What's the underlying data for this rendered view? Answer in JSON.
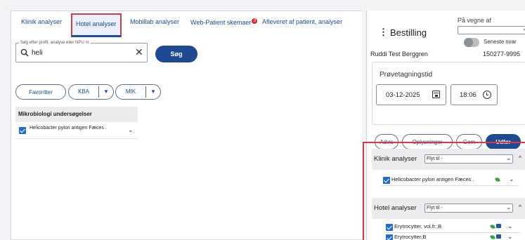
{
  "tabs": [
    {
      "label": "Klinik analyser",
      "active": false
    },
    {
      "label": "Hotel analyser",
      "active": true
    },
    {
      "label": "Mobillab analyser",
      "active": false
    },
    {
      "label": "Web-Patient skemaer",
      "active": false,
      "badge": "3"
    },
    {
      "label": "Afleveret af patient, analyser",
      "active": false
    }
  ],
  "search": {
    "legend": "Søg efter profil, analyse eller NPU nr",
    "value": "heli",
    "button_label": "Søg"
  },
  "filters": {
    "favorites_label": "Favoritter",
    "kba_label": "KBA",
    "mik_label": "MIK",
    "filter_symbol": "▼"
  },
  "results": {
    "group_title": "Mikrobiologi undersøgelser",
    "items": [
      {
        "label": "Helicobacter pylori antigen Fæces .",
        "checked": true
      }
    ]
  },
  "order": {
    "title": "Bestilling",
    "on_behalf_label": "På vegne af",
    "on_behalf_value": "",
    "latest_answer_label": "Seneste svar",
    "patient_name": "Ruddi Test Berggren",
    "patient_id": "150277-9995",
    "sampling_label": "Prøvetagningstid",
    "date": "03-12-2025",
    "time": "18:06",
    "buttons": {
      "advis": "Advis",
      "info": "Oplysninger",
      "save": "Gem",
      "execute": "Udfør"
    }
  },
  "sections": [
    {
      "title": "Klinik analyser",
      "move_label": "Flyt til -",
      "items": [
        {
          "label": "Helicobacter pylori antigen Fæces .",
          "checked": true
        }
      ]
    },
    {
      "title": "Hotel analyser",
      "move_label": "Flyt til -",
      "items": [
        {
          "label": "Erytrocytter, vol.fr.;B",
          "checked": true
        },
        {
          "label": "Erytrocytter;B",
          "checked": true
        }
      ]
    }
  ],
  "colors": {
    "primary": "#1d4a93",
    "link": "#1a4fa0",
    "highlight": "#d33a46",
    "badge": "#d62b2b",
    "checkbox": "#1f6fd3"
  }
}
